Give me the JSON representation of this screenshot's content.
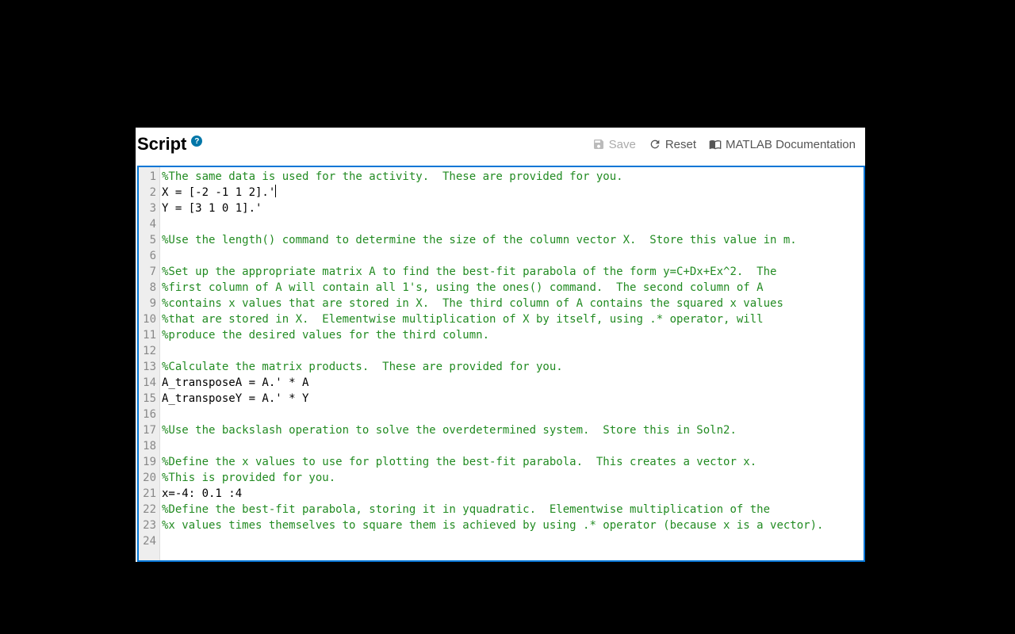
{
  "header": {
    "title": "Script",
    "help_symbol": "?"
  },
  "actions": {
    "save": "Save",
    "reset": "Reset",
    "docs": "MATLAB Documentation"
  },
  "editor": {
    "cursor_line_index": 1,
    "lines": [
      {
        "n": 1,
        "type": "comment",
        "text": "%The same data is used for the activity.  These are provided for you."
      },
      {
        "n": 2,
        "type": "plain",
        "text": "X = [-2 -1 1 2].'"
      },
      {
        "n": 3,
        "type": "plain",
        "text": "Y = [3 1 0 1].'"
      },
      {
        "n": 4,
        "type": "plain",
        "text": ""
      },
      {
        "n": 5,
        "type": "comment",
        "text": "%Use the length() command to determine the size of the column vector X.  Store this value in m."
      },
      {
        "n": 6,
        "type": "plain",
        "text": ""
      },
      {
        "n": 7,
        "type": "comment",
        "text": "%Set up the appropriate matrix A to find the best-fit parabola of the form y=C+Dx+Ex^2.  The"
      },
      {
        "n": 8,
        "type": "comment",
        "text": "%first column of A will contain all 1's, using the ones() command.  The second column of A"
      },
      {
        "n": 9,
        "type": "comment",
        "text": "%contains x values that are stored in X.  The third column of A contains the squared x values"
      },
      {
        "n": 10,
        "type": "comment",
        "text": "%that are stored in X.  Elementwise multiplication of X by itself, using .* operator, will"
      },
      {
        "n": 11,
        "type": "comment",
        "text": "%produce the desired values for the third column."
      },
      {
        "n": 12,
        "type": "plain",
        "text": ""
      },
      {
        "n": 13,
        "type": "comment",
        "text": "%Calculate the matrix products.  These are provided for you."
      },
      {
        "n": 14,
        "type": "plain",
        "text": "A_transposeA = A.' * A"
      },
      {
        "n": 15,
        "type": "plain",
        "text": "A_transposeY = A.' * Y"
      },
      {
        "n": 16,
        "type": "plain",
        "text": ""
      },
      {
        "n": 17,
        "type": "comment",
        "text": "%Use the backslash operation to solve the overdetermined system.  Store this in Soln2."
      },
      {
        "n": 18,
        "type": "plain",
        "text": ""
      },
      {
        "n": 19,
        "type": "comment",
        "text": "%Define the x values to use for plotting the best-fit parabola.  This creates a vector x."
      },
      {
        "n": 20,
        "type": "comment",
        "text": "%This is provided for you."
      },
      {
        "n": 21,
        "type": "plain",
        "text": "x=-4: 0.1 :4"
      },
      {
        "n": 22,
        "type": "comment",
        "text": "%Define the best-fit parabola, storing it in yquadratic.  Elementwise multiplication of the"
      },
      {
        "n": 23,
        "type": "comment",
        "text": "%x values times themselves to square them is achieved by using .* operator (because x is a vector)."
      },
      {
        "n": 24,
        "type": "plain",
        "text": ""
      }
    ]
  }
}
